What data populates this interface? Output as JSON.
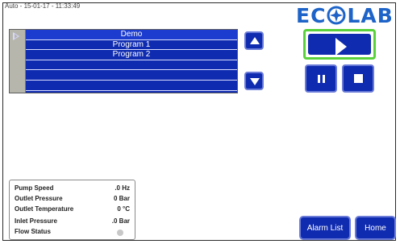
{
  "status_bar": {
    "text": "Auto - 15-01-17 - 11:33:49"
  },
  "brand": {
    "logo_text": "ECOLAB",
    "color": "#1d63c8"
  },
  "program_list": {
    "items": [
      "Demo",
      "Program 1",
      "Program 2",
      "",
      "",
      ""
    ],
    "selected_index": 0
  },
  "controls": {
    "up_icon": "arrow-up-icon",
    "down_icon": "arrow-down-icon",
    "play_icon": "play-icon",
    "pause_icon": "pause-icon",
    "stop_icon": "stop-icon",
    "active_color": "#58d13b",
    "button_color": "#0f2bb0"
  },
  "status_panel": {
    "rows": [
      {
        "label": "Pump Speed",
        "value": ".0 Hz"
      },
      {
        "label": "Outlet Pressure",
        "value": "0 Bar"
      },
      {
        "label": "Outlet Temperature",
        "value": "0 °C"
      },
      {
        "label": "Inlet Pressure",
        "value": ".0 Bar"
      },
      {
        "label": "Flow Status",
        "value": ""
      }
    ]
  },
  "nav": {
    "alarm_list": "Alarm List",
    "home": "Home"
  }
}
